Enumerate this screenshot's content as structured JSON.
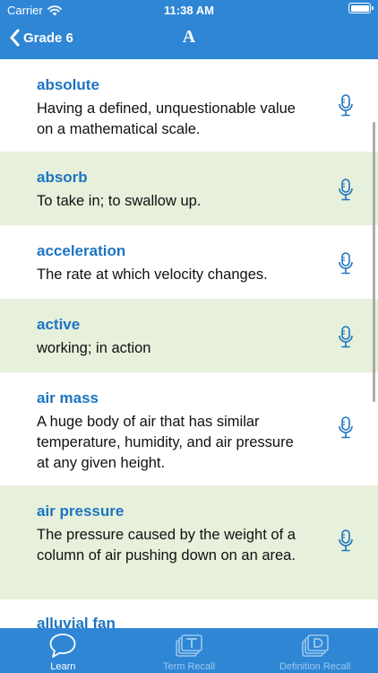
{
  "status_bar": {
    "carrier": "Carrier",
    "time": "11:38 AM"
  },
  "nav": {
    "back_label": "Grade 6",
    "title": "A"
  },
  "colors": {
    "accent": "#2f86d5",
    "term": "#1d74c2",
    "alt_row": "#e6f0db"
  },
  "entries": [
    {
      "term": "absolute",
      "definition": "Having a defined, unquestionable value on a mathematical scale.",
      "icon": "microphone-icon"
    },
    {
      "term": "absorb",
      "definition": "To take in; to swallow up.",
      "icon": "microphone-icon"
    },
    {
      "term": "acceleration",
      "definition": "The rate at which velocity changes.",
      "icon": "microphone-icon"
    },
    {
      "term": "active",
      "definition": "working; in action",
      "icon": "microphone-icon"
    },
    {
      "term": "air mass",
      "definition": "A huge body of air that has similar temperature, humidity, and air pressure at any given height.",
      "icon": "microphone-icon"
    },
    {
      "term": "air pressure",
      "definition": "The pressure caused by the weight of a column of air pushing down on an area.",
      "icon": "microphone-icon"
    },
    {
      "term": "alluvial fan",
      "definition": "",
      "icon": "microphone-icon"
    }
  ],
  "tabs": [
    {
      "label": "Learn",
      "icon": "chat-bubble-icon",
      "active": true
    },
    {
      "label": "Term Recall",
      "icon": "term-cards-icon",
      "active": false
    },
    {
      "label": "Definition Recall",
      "icon": "definition-cards-icon",
      "active": false
    }
  ]
}
